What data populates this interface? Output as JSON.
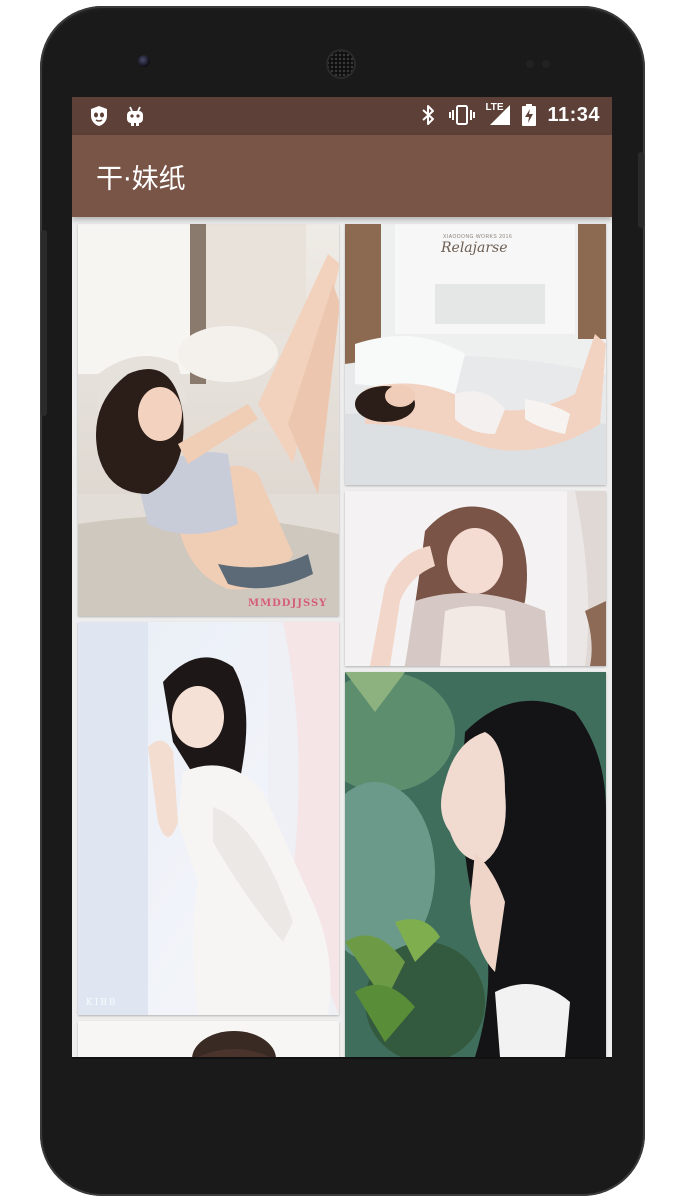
{
  "status_bar": {
    "time": "11:34",
    "left_icons": [
      "shield-face-icon",
      "android-robot-icon"
    ],
    "right_icons": [
      "bluetooth-icon",
      "vibrate-icon",
      "lte-signal-icon",
      "battery-charging-icon"
    ],
    "network_label": "LTE",
    "background": "#5d4037"
  },
  "toolbar": {
    "title": "干·妹纸",
    "background": "#795548"
  },
  "gallery": {
    "photos": [
      {
        "subject": "woman reclining on sofa",
        "watermark": "MMDDJJSSY"
      },
      {
        "subject": "woman lying on bed by window",
        "watermark": "Relajarse",
        "watermark_caption": "XIAODONG WORKS 2016"
      },
      {
        "subject": "woman with wavy hair near curtain",
        "watermark": ""
      },
      {
        "subject": "woman in white shirt by sheer curtain",
        "watermark": "KIBB"
      },
      {
        "subject": "woman profile among green leaves",
        "watermark": ""
      },
      {
        "subject": "partial photo at bottom",
        "watermark": ""
      }
    ]
  }
}
